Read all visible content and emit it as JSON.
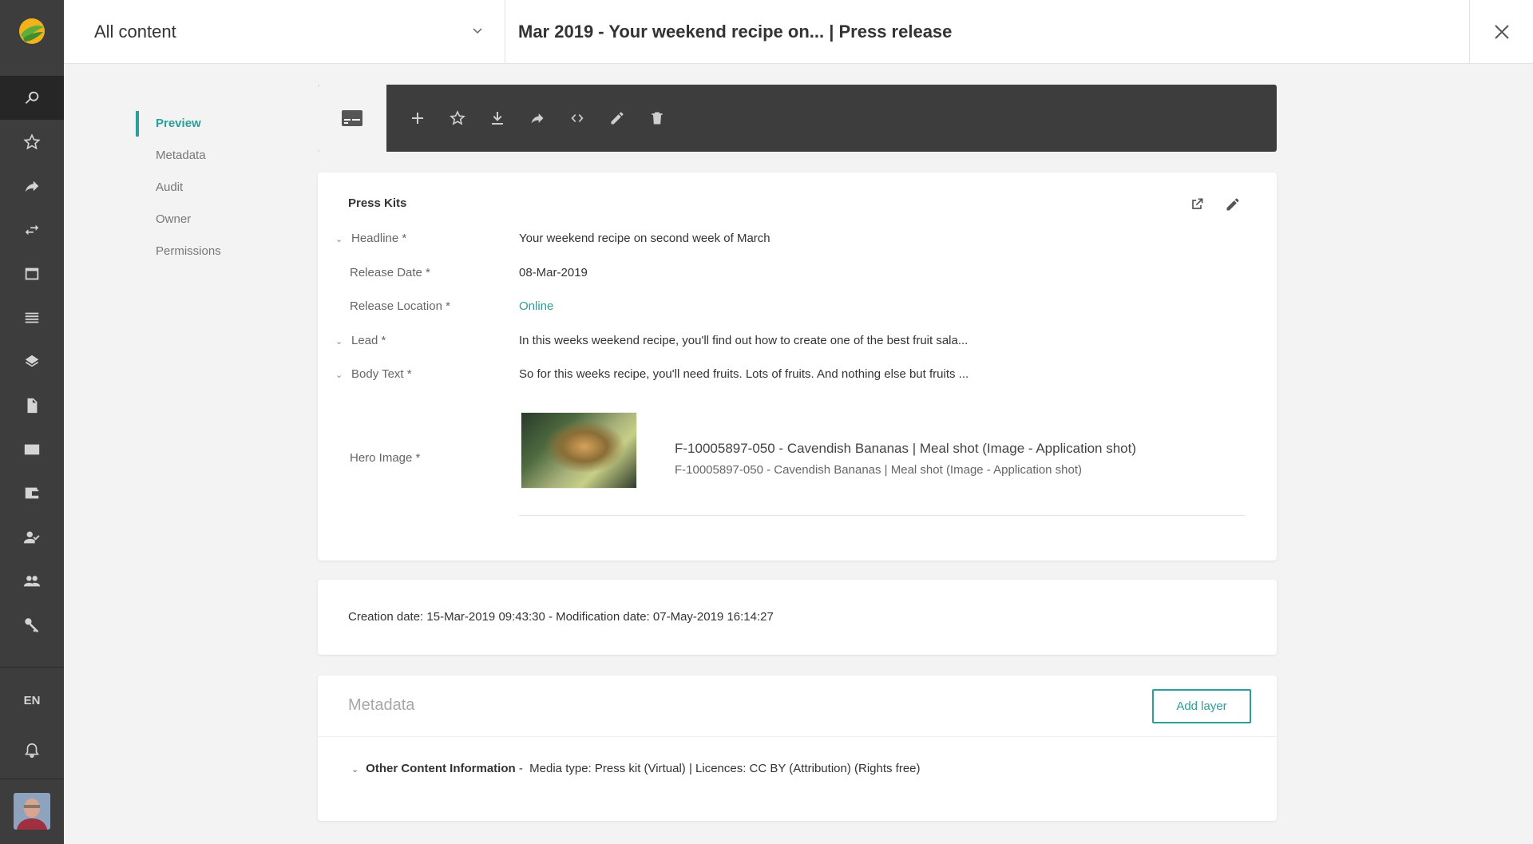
{
  "rail": {
    "icons": [
      "search-icon",
      "star-icon",
      "share-icon",
      "transfer-icon",
      "window-icon",
      "list-icon",
      "layers-icon",
      "document-icon",
      "card-icon",
      "wallet-icon",
      "user-check-icon",
      "users-icon",
      "key-icon"
    ],
    "language": "EN"
  },
  "topbar": {
    "scope_label": "All content",
    "title": "Mar 2019 - Your weekend recipe on... | Press release"
  },
  "sidenav": {
    "items": [
      {
        "label": "Preview",
        "active": true
      },
      {
        "label": "Metadata",
        "active": false
      },
      {
        "label": "Audit",
        "active": false
      },
      {
        "label": "Owner",
        "active": false
      },
      {
        "label": "Permissions",
        "active": false
      }
    ]
  },
  "toolbar": {
    "actions": [
      "add-icon",
      "star-icon",
      "download-icon",
      "share-icon",
      "code-icon",
      "edit-icon",
      "delete-icon"
    ]
  },
  "presskit": {
    "title": "Press Kits",
    "fields": {
      "headline": {
        "label": "Headline *",
        "value": "Your weekend recipe on second week of March"
      },
      "release_date": {
        "label": "Release Date *",
        "value": "08-Mar-2019"
      },
      "release_location": {
        "label": "Release Location *",
        "value": "Online"
      },
      "lead": {
        "label": "Lead *",
        "value": "In this weeks weekend recipe, you'll find out how to create one of the best fruit sala..."
      },
      "body_text": {
        "label": "Body Text *",
        "value": "So for this weeks recipe, you'll need fruits. Lots of fruits. And nothing else but fruits ..."
      },
      "hero_image": {
        "label": "Hero Image *",
        "title": "F-10005897-050 - Cavendish Bananas | Meal shot (Image - Application shot)",
        "subtitle": "F-10005897-050 - Cavendish Bananas | Meal shot (Image - Application shot)"
      }
    }
  },
  "dates": "Creation date: 15-Mar-2019 09:43:30 - Modification date: 07-May-2019 16:14:27",
  "metadata": {
    "title": "Metadata",
    "add_layer_label": "Add layer",
    "section_label": "Other Content Information",
    "section_value": " -  Media type: Press kit (Virtual) | Licences: CC BY (Attribution) (Rights free)"
  },
  "colors": {
    "accent": "#2b9e9a",
    "rail": "#3d3d3d",
    "toolbar": "#3d3d3d"
  }
}
